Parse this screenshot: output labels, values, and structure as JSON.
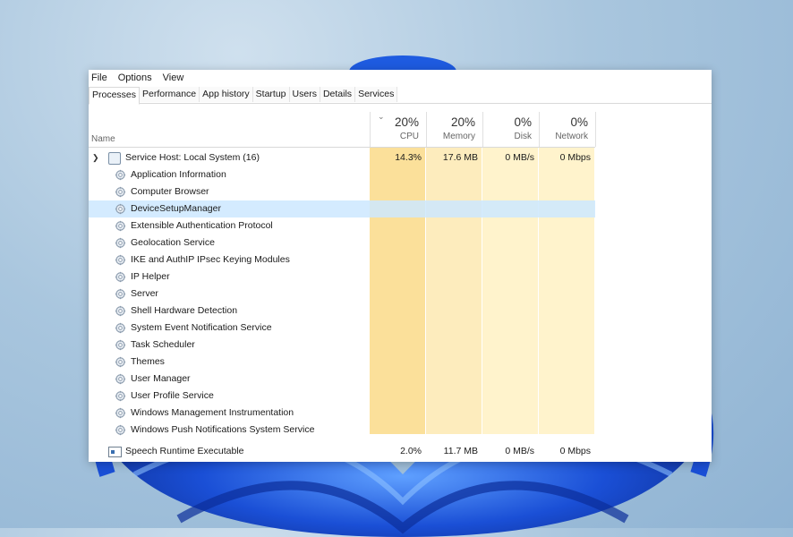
{
  "menu": [
    "File",
    "Options",
    "View"
  ],
  "tabs": [
    "Processes",
    "Performance",
    "App history",
    "Startup",
    "Users",
    "Details",
    "Services"
  ],
  "columns": {
    "name": "Name",
    "cpu": {
      "pct": "20%",
      "label": "CPU"
    },
    "memory": {
      "pct": "20%",
      "label": "Memory"
    },
    "disk": {
      "pct": "0%",
      "label": "Disk"
    },
    "network": {
      "pct": "0%",
      "label": "Network"
    }
  },
  "group": {
    "name": "Service Host: Local System (16)",
    "cpu": "14.3%",
    "memory": "17.6 MB",
    "disk": "0 MB/s",
    "network": "0 Mbps",
    "services": [
      "Application Information",
      "Computer Browser",
      "DeviceSetupManager",
      "Extensible Authentication Protocol",
      "Geolocation Service",
      "IKE and AuthIP IPsec Keying Modules",
      "IP Helper",
      "Server",
      "Shell Hardware Detection",
      "System Event Notification Service",
      "Task Scheduler",
      "Themes",
      "User Manager",
      "User Profile Service",
      "Windows Management Instrumentation",
      "Windows Push Notifications System Service"
    ],
    "selected_index": 2
  },
  "process": {
    "name": "Speech Runtime Executable",
    "cpu": "2.0%",
    "memory": "11.7 MB",
    "disk": "0 MB/s",
    "network": "0 Mbps"
  },
  "colors": {
    "cpu_bg": "#fbe09a",
    "mem_bg": "#fdecbd",
    "disk_bg": "#fff3cc",
    "net_bg": "#fff3cc",
    "selection": "#cce8ff",
    "bloom": "#1a4fd6"
  }
}
